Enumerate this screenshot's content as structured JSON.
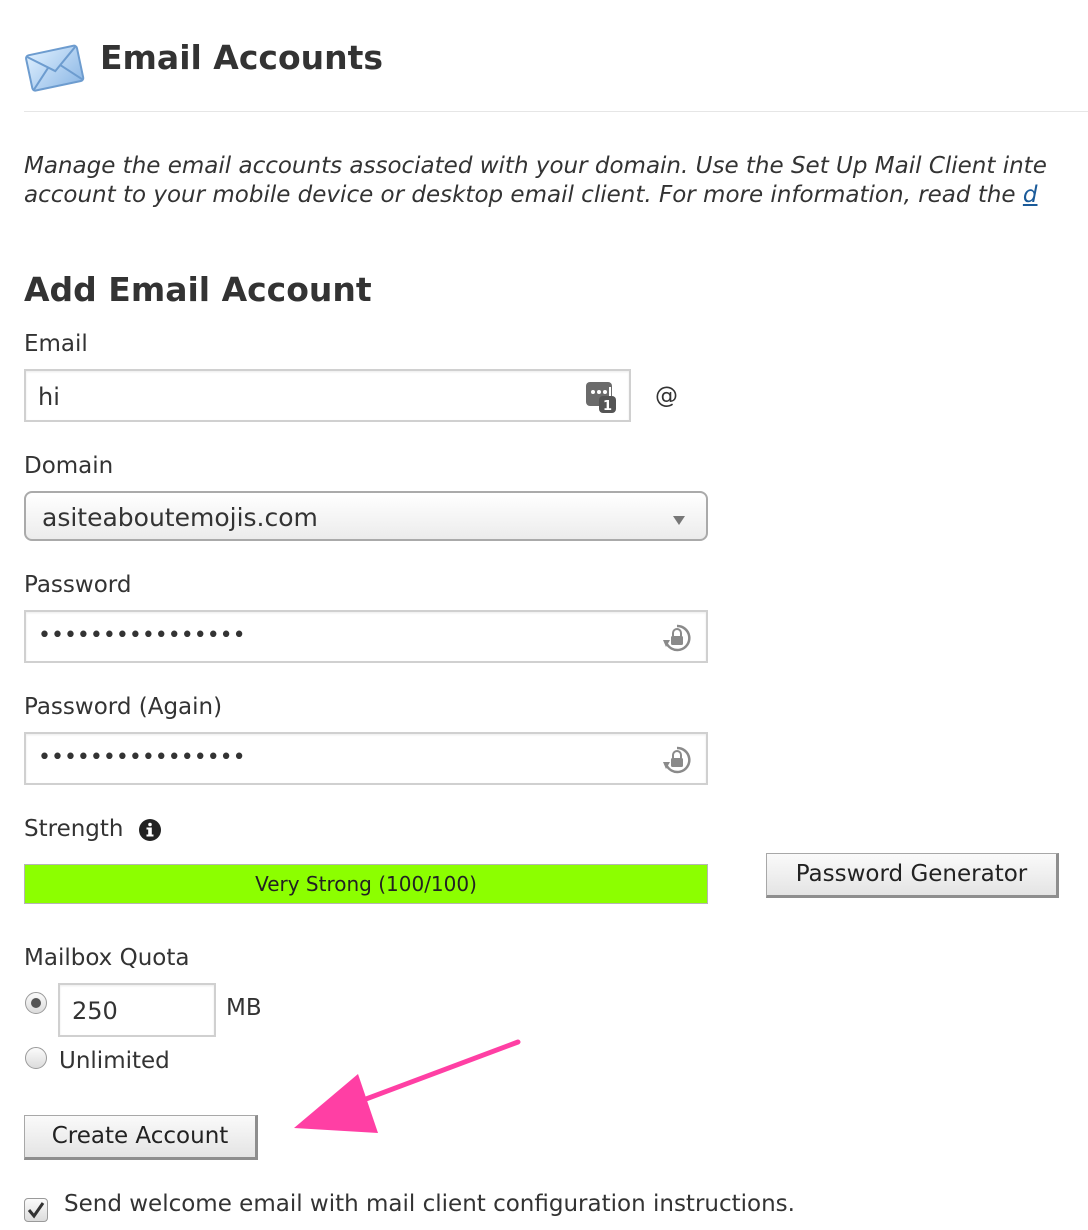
{
  "header": {
    "title": "Email Accounts",
    "icon": "envelope-icon"
  },
  "description": {
    "line1": "Manage the email accounts associated with your domain. Use the Set Up Mail Client inte",
    "line2_text": "account to your mobile device or desktop email client. For more information, read the ",
    "line2_link": "d"
  },
  "form": {
    "section_title": "Add Email Account",
    "email_label": "Email",
    "email_value": "hi",
    "at_sign": "@",
    "domain_label": "Domain",
    "domain_value": "asiteaboutemojis.com",
    "password_label": "Password",
    "password_value": "••••••••••••••••",
    "password_again_label": "Password (Again)",
    "password_again_value": "••••••••••••••••",
    "strength_label": "Strength",
    "strength_text": "Very Strong (100/100)",
    "strength_score": 100,
    "strength_color": "#8cff00",
    "password_generator_label": "Password Generator",
    "quota_label": "Mailbox Quota",
    "quota_value": "250",
    "quota_unit": "MB",
    "quota_selected": "limited",
    "unlimited_label": "Unlimited",
    "create_button_label": "Create Account",
    "welcome_email_label": "Send welcome email with mail client configuration instructions.",
    "welcome_email_checked": true
  },
  "annotation": {
    "arrow_color": "#ff3fa4"
  }
}
